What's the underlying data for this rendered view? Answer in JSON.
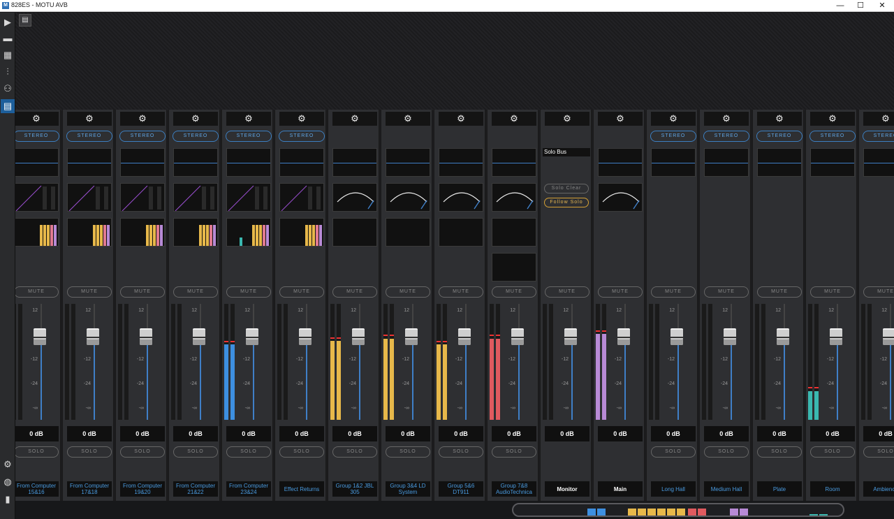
{
  "window": {
    "title": "828ES - MOTU AVB",
    "app_icon": "M",
    "minimize": "—",
    "maximize": "☐",
    "close": "✕"
  },
  "sidebar": {
    "items": [
      {
        "icon": "expand-arrow-icon",
        "glyph": "▶"
      },
      {
        "icon": "device-icon",
        "glyph": "▬"
      },
      {
        "icon": "routing-grid-icon",
        "glyph": "▦"
      },
      {
        "icon": "mixer-icon",
        "glyph": "⫶"
      },
      {
        "icon": "people-icon",
        "glyph": "⚇"
      },
      {
        "icon": "meters-icon",
        "glyph": "▤"
      }
    ],
    "bottom": [
      {
        "icon": "settings-icon",
        "glyph": "⚙"
      },
      {
        "icon": "avb-icon",
        "glyph": "◍"
      },
      {
        "icon": "usb-icon",
        "glyph": "▮"
      }
    ]
  },
  "toolbar": {
    "layout_icon": "▤"
  },
  "labels": {
    "gear": "⚙",
    "stereo": "STEREO",
    "mute": "MUTE",
    "solo": "SOLO",
    "scale": [
      "12",
      "0",
      "-12",
      "-24",
      "-∞"
    ],
    "solo_bus": "Solo Bus",
    "solo_clear": "Solo Clear",
    "follow_solo": "Follow Solo"
  },
  "colors": {
    "accent": "#3d7fc1",
    "yellow_meter": "#e7b84a",
    "blue_meter": "#3d8fe0",
    "red_meter": "#e05a5f",
    "purple_meter": "#b88ad6",
    "teal_meter": "#3ab8b0",
    "follow_solo": "#d4a035"
  },
  "channels": [
    {
      "name": "From Computer 15&16",
      "level": "0 dB",
      "type": "input",
      "meter": 0,
      "color": "none"
    },
    {
      "name": "From Computer 17&18",
      "level": "0 dB",
      "type": "input",
      "meter": 0,
      "color": "none"
    },
    {
      "name": "From Computer 19&20",
      "level": "0 dB",
      "type": "input",
      "meter": 0,
      "color": "none"
    },
    {
      "name": "From Computer 21&22",
      "level": "0 dB",
      "type": "input",
      "meter": 0,
      "color": "none"
    },
    {
      "name": "From Computer 23&24",
      "level": "0 dB",
      "type": "input",
      "meter": 0.65,
      "color": "#3d8fe0"
    },
    {
      "name": "Effect  Returns",
      "level": "0 dB",
      "type": "input",
      "meter": 0,
      "color": "none"
    },
    {
      "name": "Group 1&2 JBL 305",
      "level": "0 dB",
      "type": "group",
      "meter": 0.68,
      "color": "#e7b84a"
    },
    {
      "name": "Group 3&4 LD System",
      "level": "0 dB",
      "type": "group",
      "meter": 0.7,
      "color": "#e7b84a"
    },
    {
      "name": "Group 5&6 DT911",
      "level": "0 dB",
      "type": "group",
      "meter": 0.65,
      "color": "#e7b84a"
    },
    {
      "name": "Group 7&8 AudioTechnica",
      "level": "0 dB",
      "type": "group",
      "meter": 0.7,
      "color": "#e05a5f"
    },
    {
      "name": "Monitor",
      "level": "0 dB",
      "type": "monitor",
      "meter": 0,
      "color": "none"
    },
    {
      "name": "Main",
      "level": "0 dB",
      "type": "main",
      "meter": 0.74,
      "color": "#b88ad6"
    },
    {
      "name": "Long Hall",
      "level": "0 dB",
      "type": "reverb",
      "meter": 0,
      "color": "none"
    },
    {
      "name": "Medium Hall",
      "level": "0 dB",
      "type": "reverb",
      "meter": 0,
      "color": "none"
    },
    {
      "name": "Plate",
      "level": "0 dB",
      "type": "reverb",
      "meter": 0,
      "color": "none"
    },
    {
      "name": "Room",
      "level": "0 dB",
      "type": "reverb",
      "meter": 0.25,
      "color": "#3ab8b0"
    },
    {
      "name": "Ambience",
      "level": "0 dB",
      "type": "reverb",
      "meter": 0,
      "color": "none"
    }
  ],
  "overview_blocks": [
    "#3d8fe0",
    "#3d8fe0",
    "#e7b84a",
    "#e7b84a",
    "#e7b84a",
    "#e7b84a",
    "#e7b84a",
    "#e7b84a",
    "#e05a5f",
    "#e05a5f",
    "#b88ad6",
    "#b88ad6",
    "#3ab8b0",
    "#3ab8b0"
  ]
}
